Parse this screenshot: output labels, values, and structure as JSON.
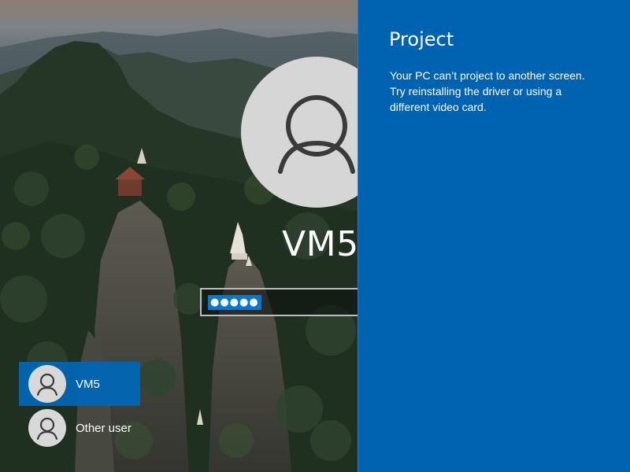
{
  "lock_screen": {
    "background": "mountain-forest-landscape"
  },
  "login": {
    "current_user": "VM5",
    "avatar_icon": "person-icon",
    "password_masked": "●●●●●",
    "accent_color": "#0078d7"
  },
  "user_list": {
    "users": [
      {
        "label": "VM5",
        "icon": "person-icon",
        "selected": true
      },
      {
        "label": "Other user",
        "icon": "person-icon",
        "selected": false
      }
    ],
    "selected_color": "#0067b8"
  },
  "project_panel": {
    "title": "Project",
    "message": "Your PC can’t project to another screen. Try reinstalling the driver or using a different video card.",
    "background_color": "#0063b1"
  }
}
